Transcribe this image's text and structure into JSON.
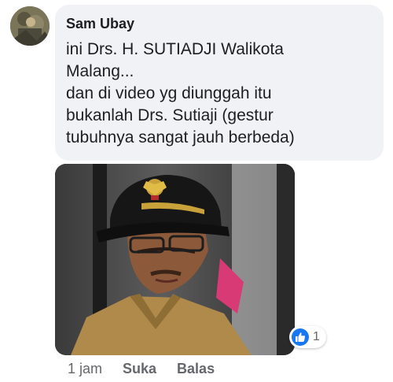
{
  "comment": {
    "author": "Sam Ubay",
    "text_lines": [
      "ini Drs. H. SUTIADJI Walikota",
      "Malang...",
      "dan di video yg diunggah itu",
      "bukanlah Drs. Sutiaji (gestur",
      "tubuhnya sangat jauh berbeda)"
    ],
    "reactions": {
      "icon": "thumbs-up-icon",
      "count": "1"
    },
    "timestamp": "1 jam",
    "like_label": "Suka",
    "reply_label": "Balas"
  },
  "colors": {
    "bubble_bg": "#f0f2f5",
    "text_primary": "#1c1e21",
    "text_secondary": "#65676b",
    "like_blue": "#1877f2"
  }
}
